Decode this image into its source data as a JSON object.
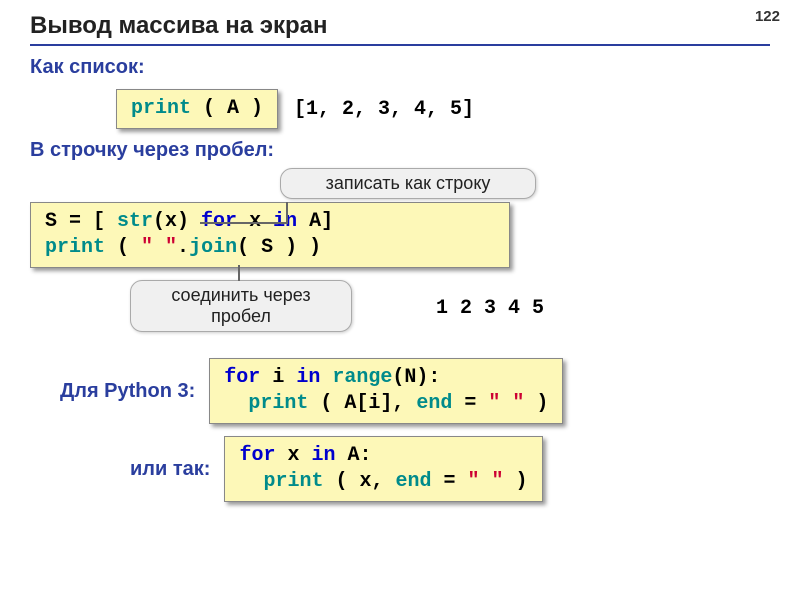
{
  "pageNumber": "122",
  "title": "Вывод массива на экран",
  "sub1": "Как список:",
  "code1_print": "print",
  "code1_rest": " ( A )",
  "output1": "[1, 2, 3, 4, 5]",
  "sub2": "В строчку через пробел:",
  "callout1": "записать как строку",
  "callout2": "соединить через\nпробел",
  "code2_line1_a": "S = [ ",
  "code2_line1_b": "str",
  "code2_line1_c": "(x) ",
  "code2_line1_d": "for",
  "code2_line1_e": " x ",
  "code2_line1_f": "in",
  "code2_line1_g": " A]",
  "code2_line2_a": "print",
  "code2_line2_b": " ( ",
  "code2_line2_c": "\" \"",
  "code2_line2_d": ".",
  "code2_line2_e": "join",
  "code2_line2_f": "( S ) )",
  "output2": "1 2 3 4 5",
  "sub3": "Для Python 3:",
  "code3_line1_a": "for",
  "code3_line1_b": " i ",
  "code3_line1_c": "in",
  "code3_line1_d": " ",
  "code3_line1_e": "range",
  "code3_line1_f": "(N):",
  "code3_line2_a": "  ",
  "code3_line2_b": "print",
  "code3_line2_c": " ( A[i], ",
  "code3_line2_d": "end",
  "code3_line2_e": " = ",
  "code3_line2_f": "\" \"",
  "code3_line2_g": " )",
  "sub4": "или так:",
  "code4_line1_a": "for",
  "code4_line1_b": " x ",
  "code4_line1_c": "in",
  "code4_line1_d": " A:",
  "code4_line2_a": "  ",
  "code4_line2_b": "print",
  "code4_line2_c": " ( x, ",
  "code4_line2_d": "end",
  "code4_line2_e": " = ",
  "code4_line2_f": "\" \"",
  "code4_line2_g": " )"
}
